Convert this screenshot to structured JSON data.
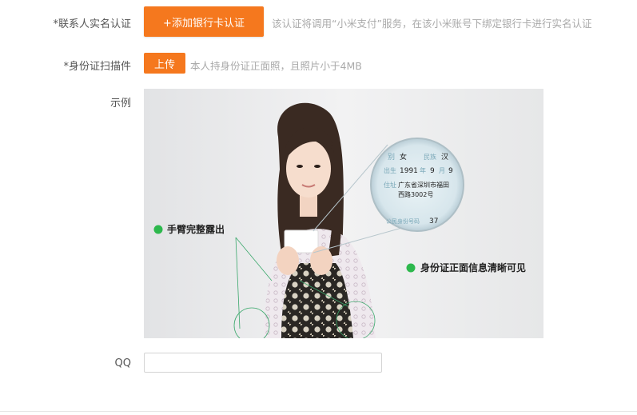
{
  "form": {
    "contact_label": "*联系人实名认证",
    "bank_button": "+添加银行卡认证",
    "bank_hint": "该认证将调用“小米支付”服务，在该小米账号下绑定银行卡进行实名认证",
    "id_label": "*身份证扫描件",
    "upload_button": "上传",
    "upload_hint": "本人持身份证正面照，且照片小于4MB",
    "example_label": "示例",
    "qq_label": "QQ",
    "qq_value": ""
  },
  "example_image": {
    "annotation_arm": "手臂完整露出",
    "annotation_id": "身份证正面信息清晰可见",
    "id_card": {
      "row1_label": "别",
      "row1_value": "女",
      "row1_label2": "民族",
      "row1_value2": "汉",
      "row2_label": "出生",
      "row2_year": "1991",
      "row2_year_unit": "年",
      "row2_month": "9",
      "row2_month_unit": "月",
      "row2_day": "9",
      "row3_label": "住址",
      "row3_value1": "广东省深圳市福田",
      "row3_value2": "西路3002号",
      "row4_label": "公民身份号码",
      "row4_value": "37"
    }
  },
  "colors": {
    "accent": "#f5781e",
    "annotation_dot": "#2db84d",
    "annotation_line": "#3aa86b"
  }
}
